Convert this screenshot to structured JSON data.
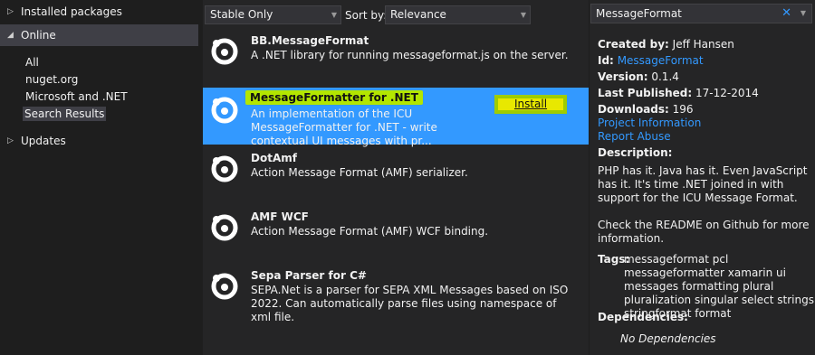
{
  "sidebar": {
    "installed_label": "Installed packages",
    "online_label": "Online",
    "online_items": [
      "All",
      "nuget.org",
      "Microsoft and .NET",
      "Search Results"
    ],
    "updates_label": "Updates"
  },
  "toolbar": {
    "filter_value": "Stable Only",
    "sort_label": "Sort by:",
    "sort_value": "Relevance"
  },
  "packages": [
    {
      "title": "BB.MessageFormat",
      "desc": "A .NET library for running messageformat.js on the server."
    },
    {
      "title": "MessageFormatter for .NET",
      "desc": "An implementation of the ICU MessageFormatter for .NET - write contextual UI messages with pr..."
    },
    {
      "title": "DotAmf",
      "desc": "Action Message Format (AMF) serializer."
    },
    {
      "title": "AMF WCF",
      "desc": "Action Message Format (AMF) WCF binding."
    },
    {
      "title": "Sepa Parser for C#",
      "desc": "SEPA.Net is a parser for SEPA XML Messages based on ISO 2022. Can automatically parse files using namespace of xml file."
    }
  ],
  "install_label": "Install",
  "details": {
    "search_value": "MessageFormat",
    "search_clear": "✕",
    "created_by_label": "Created by:",
    "created_by_value": "Jeff Hansen",
    "id_label": "Id:",
    "id_value": "MessageFormat",
    "version_label": "Version:",
    "version_value": "0.1.4",
    "last_published_label": "Last Published:",
    "last_published_value": "17-12-2014",
    "downloads_label": "Downloads:",
    "downloads_value": "196",
    "project_info_link": "Project Information",
    "report_abuse_link": "Report Abuse",
    "description_label": "Description:",
    "description_p1": "PHP has it. Java has it. Even JavaScript has it. It's time .NET joined in with support for the ICU Message Format.",
    "description_p2": "Check the README on Github for more information.",
    "tags_label": "Tags:",
    "tags_value": "messageformat pcl messageformatter xamarin ui messages formatting plural pluralization singular select strings stringformat format",
    "dependencies_label": "Dependencies:",
    "dependencies_value": "No Dependencies"
  },
  "colors": {
    "accent": "#3399ff",
    "highlight": "#b3e600",
    "install_button": "#e8e800"
  }
}
